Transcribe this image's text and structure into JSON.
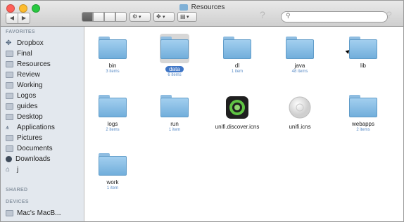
{
  "window": {
    "title": "Resources"
  },
  "toolbar": {
    "back": "◀",
    "forward": "▶",
    "help_left": "?",
    "help_right": "?",
    "search_placeholder": ""
  },
  "sidebar": {
    "favorites_header": "FAVORITES",
    "shared_header": "SHARED",
    "devices_header": "DEVICES",
    "favorites": [
      {
        "label": "Dropbox",
        "icon": "dropbox-icon"
      },
      {
        "label": "Final",
        "icon": "folder-icon"
      },
      {
        "label": "Resources",
        "icon": "folder-icon"
      },
      {
        "label": "Review",
        "icon": "folder-icon"
      },
      {
        "label": "Working",
        "icon": "folder-icon"
      },
      {
        "label": "Logos",
        "icon": "folder-icon"
      },
      {
        "label": "guides",
        "icon": "folder-icon"
      },
      {
        "label": "Desktop",
        "icon": "desktop-icon"
      },
      {
        "label": "Applications",
        "icon": "applications-icon"
      },
      {
        "label": "Pictures",
        "icon": "pictures-icon"
      },
      {
        "label": "Documents",
        "icon": "documents-icon"
      },
      {
        "label": "Downloads",
        "icon": "downloads-icon"
      },
      {
        "label": "j",
        "icon": "home-icon"
      }
    ],
    "devices": [
      {
        "label": "Mac's MacB...",
        "icon": "laptop-icon"
      }
    ]
  },
  "files": [
    {
      "name": "bin",
      "sub": "3 items",
      "kind": "folder"
    },
    {
      "name": "data",
      "sub": "6 items",
      "kind": "folder",
      "selected": true
    },
    {
      "name": "dl",
      "sub": "1 item",
      "kind": "folder"
    },
    {
      "name": "java",
      "sub": "48 items",
      "kind": "folder"
    },
    {
      "name": "lib",
      "sub": "",
      "kind": "folder"
    },
    {
      "name": "logs",
      "sub": "2 items",
      "kind": "folder"
    },
    {
      "name": "run",
      "sub": "1 item",
      "kind": "folder"
    },
    {
      "name": "unifi.discover.icns",
      "sub": "",
      "kind": "icns-dark"
    },
    {
      "name": "unifi.icns",
      "sub": "",
      "kind": "icns-light"
    },
    {
      "name": "webapps",
      "sub": "2 items",
      "kind": "folder"
    },
    {
      "name": "work",
      "sub": "1 item",
      "kind": "folder"
    }
  ],
  "colors": {
    "selection": "#3e75c6",
    "folder": "#8fbde1",
    "subtext": "#5b8cc6"
  }
}
